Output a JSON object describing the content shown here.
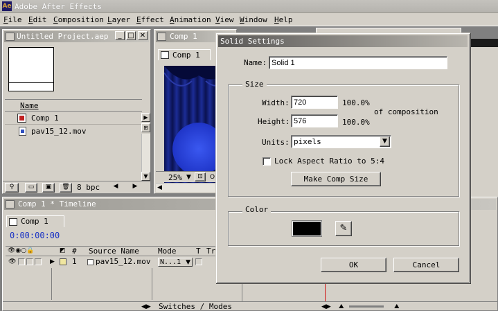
{
  "app": {
    "title": "Adobe After Effects",
    "icon": "after-effects-logo-icon"
  },
  "menu": [
    {
      "key": "F",
      "rest": "ile"
    },
    {
      "key": "E",
      "rest": "dit"
    },
    {
      "key": "C",
      "rest": "omposition"
    },
    {
      "key": "L",
      "rest": "ayer"
    },
    {
      "key": "E",
      "rest": "ffect"
    },
    {
      "key": "A",
      "rest": "nimation"
    },
    {
      "key": "V",
      "rest": "iew"
    },
    {
      "key": "W",
      "rest": "indow"
    },
    {
      "key": "H",
      "rest": "elp"
    }
  ],
  "project": {
    "title": "Untitled Project.aep",
    "column_name": "Name",
    "items": [
      {
        "label": "Comp 1",
        "icon": "composition-icon"
      },
      {
        "label": "pav15_12.mov",
        "icon": "movie-file-icon"
      }
    ],
    "bpc": "8 bpc"
  },
  "comp_window": {
    "title": "Comp 1",
    "tab": "Comp 1",
    "zoom": "25%"
  },
  "timeline": {
    "title": "Comp 1 * Timeline",
    "tab": "Comp 1",
    "timecode": "0:00:00:00",
    "col_number": "#",
    "col_source": "Source Name",
    "col_mode": "Mode",
    "col_t": "T",
    "col_trkmat": "Trk",
    "layer_number": "1",
    "layer_name": "pav15_12.mov",
    "layer_mode": "N...1",
    "switches_label": "Switches / Modes"
  },
  "dialog": {
    "title": "Solid Settings",
    "name_label": "Name:",
    "name_value": "Solid 1",
    "size_group": "Size",
    "width_label": "Width:",
    "width_value": "720",
    "width_pct": "100.0%",
    "height_label": "Height:",
    "height_value": "576",
    "height_pct": "100.0%",
    "of_comp": "of composition",
    "units_label": "Units:",
    "units_value": "pixels",
    "lock_label": "Lock Aspect Ratio to 5:4",
    "lock_checked": false,
    "make_comp_size": "Make Comp Size",
    "color_group": "Color",
    "color_swatch": "#000000",
    "eyedropper_icon": "eyedropper-icon",
    "ok": "OK",
    "cancel": "Cancel"
  },
  "colors": {
    "curtain_blue": "#1b2c8f",
    "spotlight": "#2a48e0",
    "timecode_blue": "#1630c4"
  }
}
